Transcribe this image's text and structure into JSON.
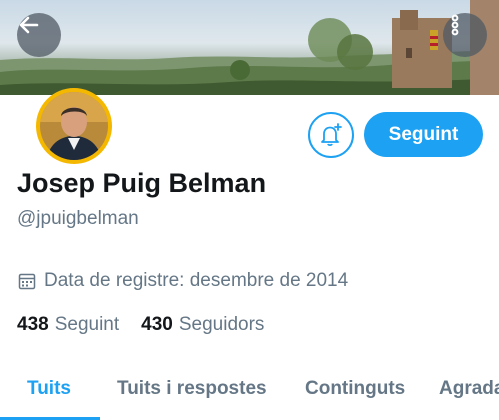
{
  "profile": {
    "name": "Josep Puig Belman",
    "handle": "@jpuigbelman",
    "joined": "Data de registre: desembre de 2014",
    "following_count": "438",
    "following_label": "Seguint",
    "followers_count": "430",
    "followers_label": "Seguidors"
  },
  "actions": {
    "follow_label": "Seguint"
  },
  "tabs": [
    {
      "label": "Tuits",
      "active": true
    },
    {
      "label": "Tuits i respostes",
      "active": false
    },
    {
      "label": "Continguts",
      "active": false
    },
    {
      "label": "Agrada",
      "active": false
    }
  ],
  "icons": {
    "back": "arrow-left-icon",
    "more": "more-vertical-icon",
    "notify": "bell-plus-icon",
    "calendar": "calendar-icon"
  },
  "colors": {
    "accent": "#1da1f2",
    "secondary_text": "#657786",
    "primary_text": "#14171a",
    "avatar_ring": "#f5b800"
  }
}
